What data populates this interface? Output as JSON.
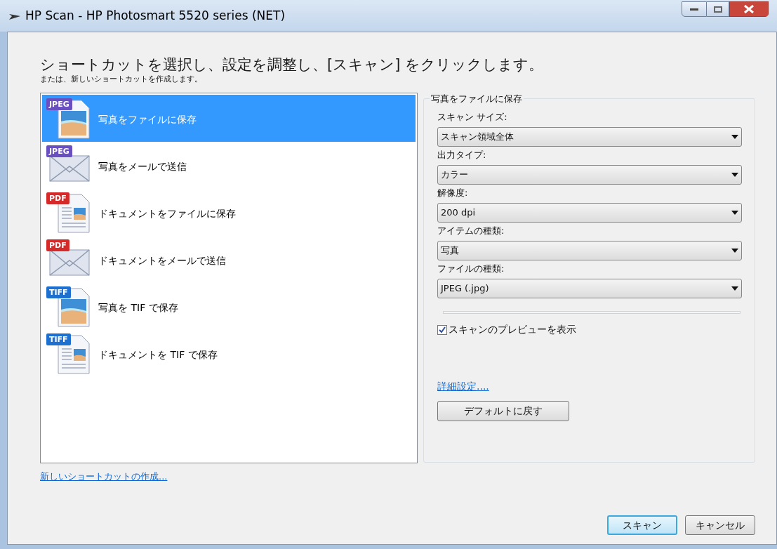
{
  "window": {
    "title": "HP Scan - HP Photosmart 5520 series (NET)"
  },
  "heading": "ショートカットを選択し、設定を調整し、[スキャン] をクリックします。",
  "subheading": "または、新しいショートカットを作成します。",
  "shortcuts": [
    {
      "badge": {
        "label": "JPEG",
        "color": "#6a4fc0"
      },
      "kind": "photo",
      "label": "写真をファイルに保存",
      "selected": true
    },
    {
      "badge": {
        "label": "JPEG",
        "color": "#6a4fc0"
      },
      "kind": "mail",
      "label": "写真をメールで送信",
      "selected": false
    },
    {
      "badge": {
        "label": "PDF",
        "color": "#d42a2a"
      },
      "kind": "document",
      "label": "ドキュメントをファイルに保存",
      "selected": false
    },
    {
      "badge": {
        "label": "PDF",
        "color": "#d42a2a"
      },
      "kind": "mail",
      "label": "ドキュメントをメールで送信",
      "selected": false
    },
    {
      "badge": {
        "label": "TIFF",
        "color": "#1d6fd0"
      },
      "kind": "photo",
      "label": "写真を TIF で保存",
      "selected": false
    },
    {
      "badge": {
        "label": "TIFF",
        "color": "#1d6fd0"
      },
      "kind": "document",
      "label": "ドキュメントを TIF で保存",
      "selected": false
    }
  ],
  "new_shortcut_link": "新しいショートカットの作成...",
  "settings": {
    "title": "写真をファイルに保存",
    "fields": [
      {
        "label": "スキャン サイズ:",
        "value": "スキャン領域全体"
      },
      {
        "label": "出力タイプ:",
        "value": "カラー"
      },
      {
        "label": "解像度:",
        "value": "200 dpi"
      },
      {
        "label": "アイテムの種類:",
        "value": "写真"
      },
      {
        "label": "ファイルの種類:",
        "value": "JPEG (.jpg)"
      }
    ],
    "preview_checkbox": {
      "label": "スキャンのプレビューを表示",
      "checked": true
    },
    "advanced_link": "詳細設定....",
    "reset_button": "デフォルトに戻す"
  },
  "buttons": [
    {
      "label": "スキャン",
      "default": true
    },
    {
      "label": "キャンセル",
      "default": false
    }
  ]
}
